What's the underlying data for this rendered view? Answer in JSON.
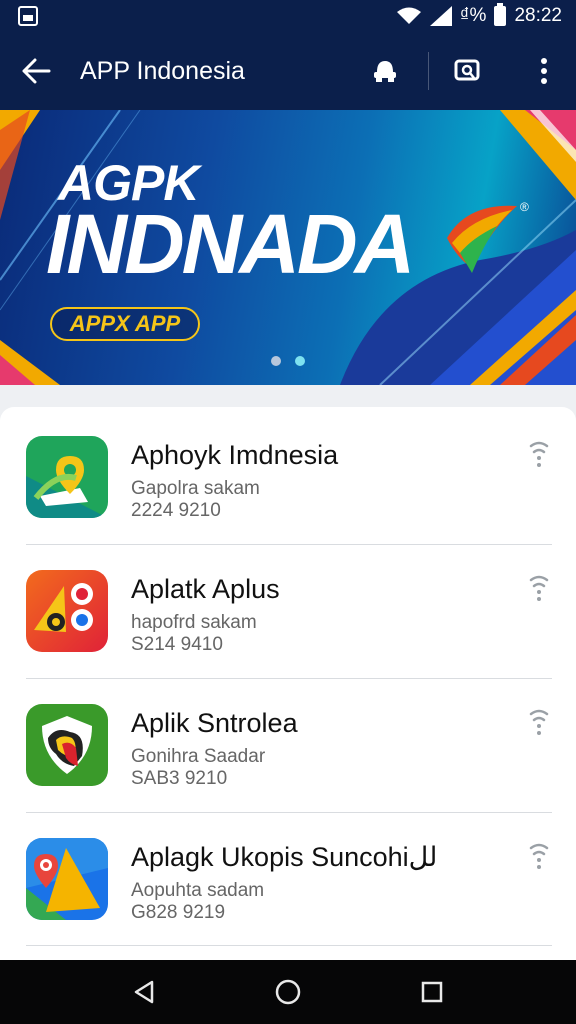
{
  "status_bar": {
    "signal_text": "₫%",
    "time": "28:22",
    "icons": [
      "gallery-icon",
      "wifi-icon",
      "cell-signal-icon",
      "battery-icon"
    ]
  },
  "app_bar": {
    "title": "APP Indonesia",
    "icons": [
      "back-arrow-icon",
      "account-icon",
      "search-icon",
      "more-vert-icon"
    ]
  },
  "banner": {
    "line1": "AGPK",
    "line2": "INDNADA",
    "reg_mark": "®",
    "pill_label": "APPX APP",
    "slides_total": 2,
    "active_slide": 2,
    "colors": {
      "pill": "#f5c518",
      "bg_main": "#0f4aa0",
      "bg_accent": "#07a2c7"
    }
  },
  "apps": [
    {
      "title": "Aphoyk Imdnesia",
      "subtitle": "Gapolra sakam",
      "meta": "2224 9210",
      "icon": "map-pin-icon"
    },
    {
      "title": "Aplatk Aplus",
      "subtitle": "hapofrd sakam",
      "meta": "S214 9410",
      "icon": "circles-app-icon"
    },
    {
      "title": "Aplik Sntrolea",
      "subtitle": "Gonihra Saadar",
      "meta": "SAB3 9210",
      "icon": "shield-app-icon"
    },
    {
      "title": "Aplagk Ukopis Suncohiلل",
      "subtitle": "Aopuhta sadam",
      "meta": "G828 9219",
      "icon": "maps-app-icon"
    }
  ],
  "nav_bar": {
    "icons": [
      "back-triangle-icon",
      "home-circle-icon",
      "recents-square-icon"
    ]
  },
  "colors": {
    "header": "#0b1f4b",
    "list_bg": "#ffffff",
    "nav": "#060607"
  }
}
